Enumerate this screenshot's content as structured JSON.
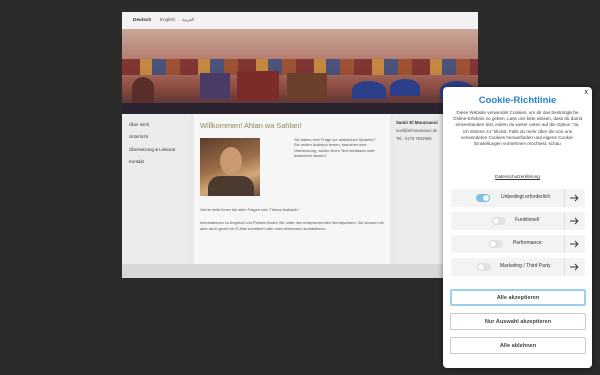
{
  "site": {
    "languages": [
      "Deutsch",
      "English",
      "العربية"
    ],
    "nav": [
      "Über mich",
      "Unterricht",
      "Übersetzung & Lektorat",
      "Kontakt"
    ],
    "main": {
      "title": "Willkommen! Ahlan wa Sahlan!",
      "intro": "Sie haben eine Frage zur arabischen Sprache? Sie wollen Arabisch lernen, brauchen eine Übersetzung, wollen einen Text verfassen oder lektorieren lassen?",
      "para1": "Gerne helfe ihnen bei allen Fragen zum Thema Arabisch!",
      "para2": "Informationen zu Angebot und Preisen finden Sie unter den entsprechenden Menüpunkten. Sie können mir aber auch gerne ein E-Mail schreiben oder mich telefonisch kontaktieren."
    },
    "contact": {
      "name": "Samir El Moussaoui",
      "email": "mail@elmoussaoui.de",
      "phone": "Tel.: 0176 7642965"
    }
  },
  "cookie": {
    "close_label": "x",
    "title": "Cookie-Richtlinie",
    "text": "Diese Website verwendet Cookies, um dir das bestmögliche Online-Erlebnis zu geben. Lass uns bitte wissen, dass du damit einverstanden bist, indem du weiter unten auf die Option \"Ja, ich stimme zu\" klickst. Falls du mehr über die von uns verwendeten Cookies herausfinden und eigene Cookie-Einstellungen vornehmen möchtest, schau",
    "privacy_link": "Datenschutzerklärung",
    "categories": [
      {
        "label": "Unbedingt erforderlich",
        "enabled": true
      },
      {
        "label": "Funktionell",
        "enabled": false
      },
      {
        "label": "Performance",
        "enabled": false
      },
      {
        "label": "Marketing / Third Party",
        "enabled": false
      }
    ],
    "buttons": {
      "accept_all": "Alle akzeptieren",
      "accept_selection": "Nur Auswahl akzeptieren",
      "reject_all": "Alle ablehnen"
    },
    "colors": {
      "accent": "#2a84c6",
      "toggle_on": "#7cc3e5"
    }
  }
}
